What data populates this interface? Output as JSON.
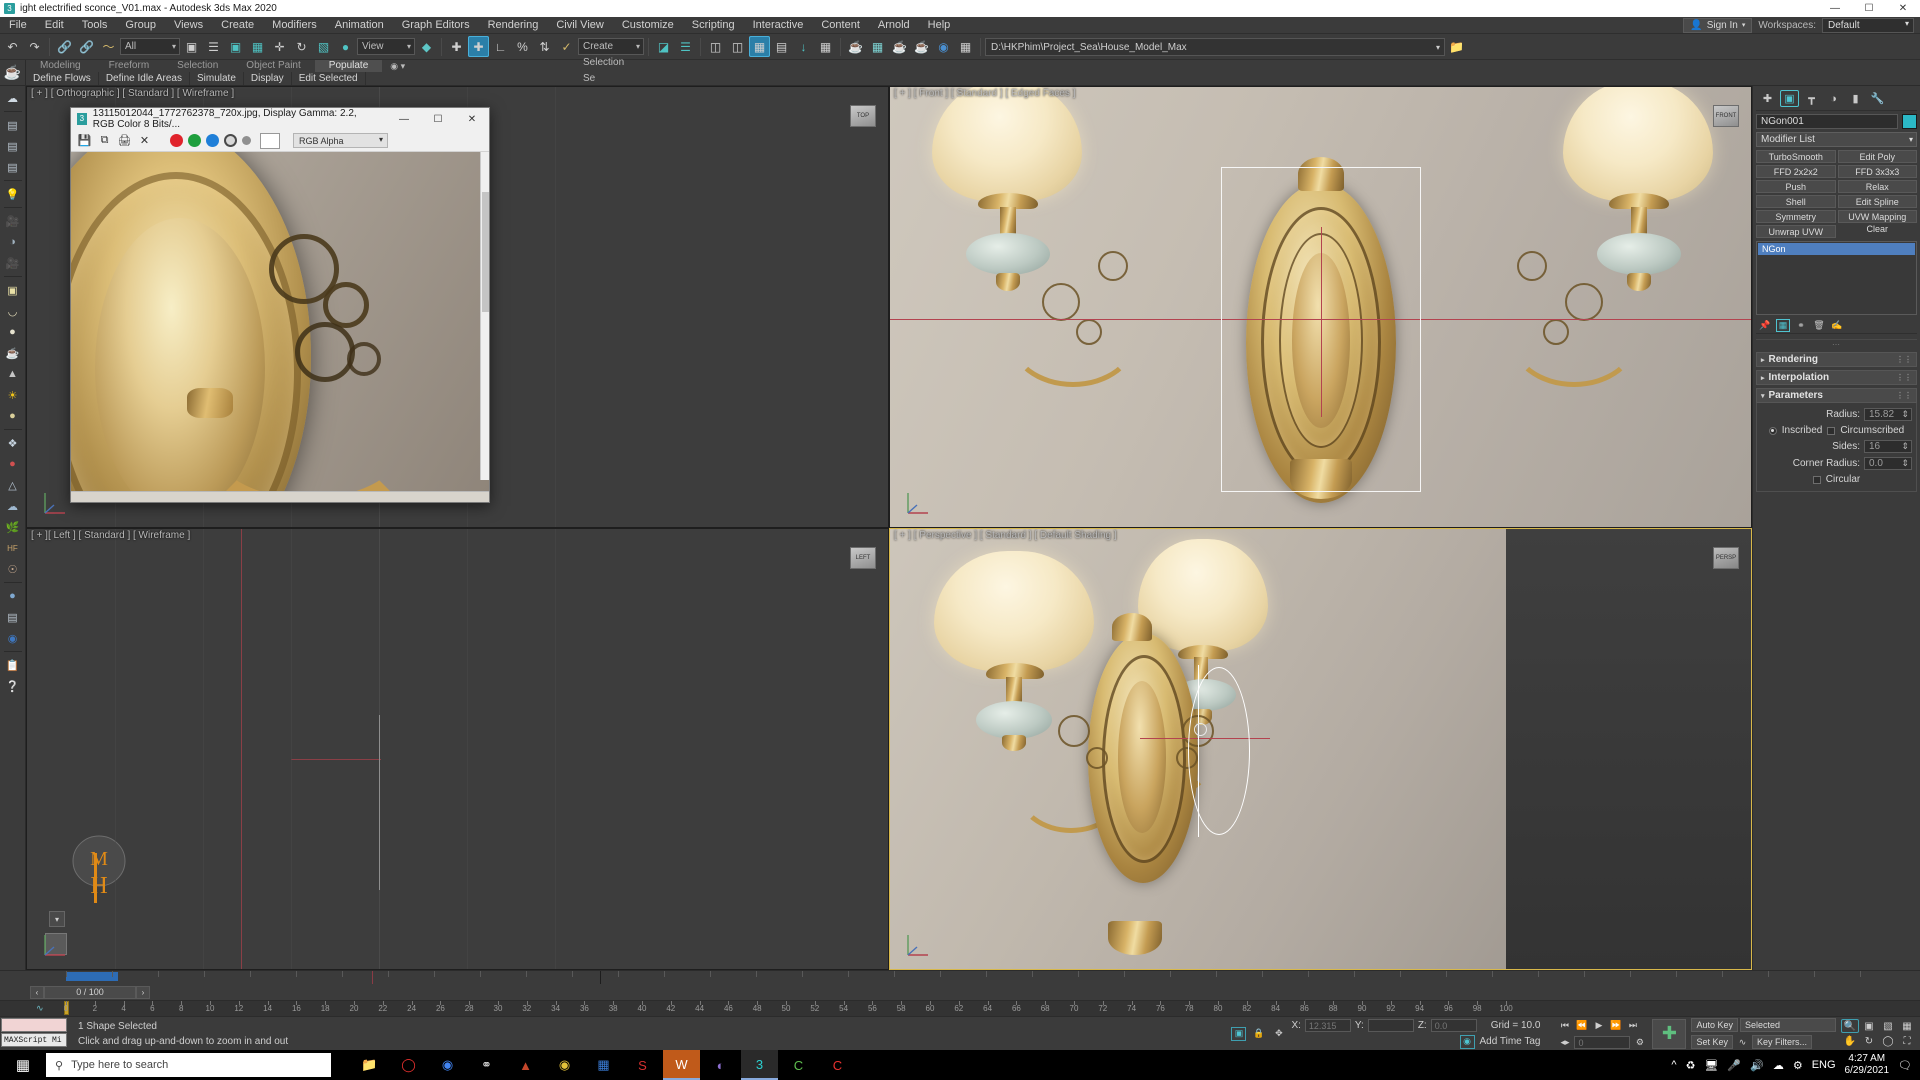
{
  "window": {
    "title": "ight electrified sconce_V01.max - Autodesk 3ds Max 2020",
    "app_icon": "3",
    "minimize": "—",
    "maximize": "☐",
    "close": "✕"
  },
  "menubar": {
    "items": [
      "File",
      "Edit",
      "Tools",
      "Group",
      "Views",
      "Create",
      "Modifiers",
      "Animation",
      "Graph Editors",
      "Rendering",
      "Civil View",
      "Customize",
      "Scripting",
      "Interactive",
      "Content",
      "Arnold",
      "Help"
    ],
    "sign_in": "Sign In",
    "workspaces_label": "Workspaces:",
    "workspace_value": "Default"
  },
  "toolbar": {
    "selection_filter": "All",
    "reference_coord": "View",
    "named_selection_set": "Create Selection Se",
    "project_path": "D:\\HKPhim\\Project_Sea\\House_Model_Max",
    "buttons": [
      "undo-icon",
      "redo-icon",
      "select-link-icon",
      "unlink-icon",
      "bind-spacewarp-icon",
      "select-object-icon",
      "select-by-name-icon",
      "rectangular-select-icon",
      "window-crossing-icon",
      "select-move-icon",
      "select-rotate-icon",
      "select-scale-icon",
      "placement-icon",
      "mirror-icon",
      "align-icon",
      "snap-toggle-icon",
      "angle-snap-icon",
      "percent-snap-icon",
      "spinner-snap-icon",
      "edit-named-selection-icon",
      "layer-manager-icon",
      "curve-editor-icon",
      "schematic-view-icon",
      "material-editor-icon",
      "render-setup-icon",
      "render-frame-icon",
      "render-production-icon",
      "render-iterative-icon",
      "activeshade-icon",
      "qr-icon",
      "grid-icon"
    ]
  },
  "ribbon": {
    "tabs": [
      "Modeling",
      "Freeform",
      "Selection",
      "Object Paint",
      "Populate"
    ],
    "active_tab": "Populate",
    "subtabs": [
      "Define Flows",
      "Define Idle Areas",
      "Simulate",
      "Display",
      "Edit Selected"
    ]
  },
  "left_toolbar": {
    "items": [
      "cloud-icon",
      "render-window-icon",
      "list-panel-icon",
      "list-panel-2-icon",
      "light-icon",
      "camera-icon",
      "helper-icon",
      "render-camera-icon",
      "box-material-icon",
      "dome-material-icon",
      "sphere-material-icon",
      "teapot-material-icon",
      "cone-material-icon",
      "sun-icon",
      "sphere-gold-icon",
      "particles-icon",
      "capsule-icon",
      "spacewarp-icon",
      "cloud-fx-icon",
      "grass-icon",
      "hair-fur-icon",
      "brain-icon",
      "glossy-sphere-icon",
      "render-to-texture-icon",
      "region-render-icon",
      "clipboard-icon",
      "help-icon"
    ]
  },
  "viewports": [
    {
      "name": "viewport-orthographic",
      "label": "[ + ] [ Orthographic ] [ Standard ] [ Wireframe ]",
      "cube": "TOP",
      "active": false
    },
    {
      "name": "viewport-front",
      "label": "[ + ] [ Front ] [ Standard ] [ Edged Faces ]",
      "cube": "FRONT",
      "active": false
    },
    {
      "name": "viewport-left",
      "label": "[ + ][ Left ] [ Standard ] [ Wireframe ]",
      "cube": "LEFT",
      "active": false
    },
    {
      "name": "viewport-perspective",
      "label": "[ + ] [ Perspective ] [ Standard ] [ Default Shading ]",
      "cube": "PERSP",
      "active": true
    }
  ],
  "image_viewer": {
    "title": "13115012044_1772762378_720x.jpg, Display Gamma: 2.2, RGB Color 8 Bits/...",
    "icon": "3",
    "minimize": "—",
    "maximize": "☐",
    "close": "✕",
    "tools": [
      "save-icon",
      "copy-icon",
      "print-icon",
      "clear-icon"
    ],
    "channels": [
      "red-channel-dot",
      "green-channel-dot",
      "blue-channel-dot",
      "alpha-channel-dot",
      "mono-channel-dot"
    ],
    "channel_colors": {
      "red": "#e0232b",
      "green": "#1f9f3d",
      "blue": "#1f7fd8",
      "alpha": "#2f2f2f",
      "mono": "#808080"
    },
    "mode": "RGB Alpha"
  },
  "command_panel": {
    "tabs": [
      "create-tab-icon",
      "modify-tab-icon",
      "hierarchy-tab-icon",
      "motion-tab-icon",
      "display-tab-icon",
      "utilities-tab-icon"
    ],
    "active_tab_index": 1,
    "object_name": "NGon001",
    "object_color": "#2bb8c6",
    "modifier_list_label": "Modifier List",
    "modifier_buttons": [
      "TurboSmooth",
      "Edit Poly",
      "FFD 2x2x2",
      "FFD 3x3x3",
      "Push",
      "Relax",
      "Shell",
      "Edit Spline",
      "Symmetry",
      "UVW Mapping Clear",
      "Unwrap UVW"
    ],
    "stack_items": [
      "NGon"
    ],
    "stack_selected": "NGon",
    "stack_tools": [
      "pin-stack-icon",
      "show-end-result-icon",
      "make-unique-icon",
      "remove-modifier-icon",
      "configure-sets-icon"
    ],
    "rollouts": [
      {
        "name": "Rendering",
        "expanded": false
      },
      {
        "name": "Interpolation",
        "expanded": false
      },
      {
        "name": "Parameters",
        "expanded": true
      }
    ],
    "parameters": {
      "radius_label": "Radius:",
      "radius_value": "15.82",
      "inscribed_label": "Inscribed",
      "inscribed_selected": true,
      "circumscribed_label": "Circumscribed",
      "circumscribed_selected": false,
      "sides_label": "Sides:",
      "sides_value": "16",
      "corner_radius_label": "Corner Radius:",
      "corner_radius_value": "0.0",
      "circular_label": "Circular",
      "circular_checked": false
    }
  },
  "timeline": {
    "frame_display": "0 / 100",
    "prev_arrow": "‹",
    "next_arrow": "›",
    "ticks": [
      "0",
      "2",
      "4",
      "6",
      "8",
      "10",
      "12",
      "14",
      "16",
      "18",
      "20",
      "22",
      "24",
      "26",
      "28",
      "30",
      "32",
      "34",
      "36",
      "38",
      "40",
      "42",
      "44",
      "46",
      "48",
      "50",
      "52",
      "54",
      "56",
      "58",
      "60",
      "62",
      "64",
      "66",
      "68",
      "70",
      "72",
      "74",
      "76",
      "78",
      "80",
      "82",
      "84",
      "86",
      "88",
      "90",
      "92",
      "94",
      "96",
      "98",
      "100"
    ]
  },
  "statusbar": {
    "mini_listener": "MAXScript Mi",
    "selection_status": "1 Shape Selected",
    "prompt": "Click and drag up-and-down to zoom in and out",
    "x_label": "X:",
    "x_value": "12.315",
    "y_label": "Y:",
    "y_value": "",
    "z_label": "Z:",
    "z_value": "0.0",
    "grid_label": "Grid = 10.0",
    "add_time_tag": "Add Time Tag",
    "auto_key": "Auto Key",
    "set_key": "Set Key",
    "key_mode": "Selected",
    "key_filters": "Key Filters...",
    "key_frame_value": "0",
    "transport": [
      "go-to-start-icon",
      "previous-frame-icon",
      "play-animation-icon",
      "next-frame-icon",
      "go-to-end-icon"
    ],
    "nav_buttons": [
      "zoom-icon",
      "zoom-all-icon",
      "zoom-extents-icon",
      "zoom-region-icon",
      "pan-icon",
      "orbit-icon",
      "maximize-viewport-icon",
      "field-of-view-icon"
    ]
  },
  "taskbar": {
    "search_placeholder": "Type here to search",
    "search_icon": "search-icon",
    "start_icon": "windows-start-icon",
    "apps": [
      {
        "name": "file-explorer",
        "glyph": "🗂",
        "color": "#f2b33d",
        "active": false
      },
      {
        "name": "opera-browser",
        "glyph": "O",
        "color": "#e8312f",
        "active": false
      },
      {
        "name": "chrome-browser",
        "glyph": "◉",
        "color": "#4285f4",
        "active": false
      },
      {
        "name": "photoshop-app",
        "glyph": "@",
        "color": "#d8d8d8",
        "active": false
      },
      {
        "name": "media-app",
        "glyph": "▲",
        "color": "#c4462a",
        "active": false
      },
      {
        "name": "film-app",
        "glyph": "◎",
        "color": "#e3c23a",
        "active": false
      },
      {
        "name": "photos-app",
        "glyph": "▣",
        "color": "#3a7bd5",
        "active": false
      },
      {
        "name": "skype-app",
        "glyph": "S",
        "color": "#d32f2f",
        "active": false
      },
      {
        "name": "word-app",
        "glyph": "W",
        "color": "#ffffff",
        "active": true
      },
      {
        "name": "utorrent-app",
        "glyph": "◐",
        "color": "#8d6fd1",
        "active": false
      },
      {
        "name": "3dsmax-app",
        "glyph": "3",
        "color": "#2b9e9e",
        "active": true
      },
      {
        "name": "coreldraw-app",
        "glyph": "C",
        "color": "#5fbf4f",
        "active": false
      },
      {
        "name": "corelphoto-app",
        "glyph": "C",
        "color": "#e8312f",
        "active": false
      }
    ],
    "tray": [
      "show-hidden-icon",
      "onedrive-sync-icon",
      "network-icon",
      "microphone-icon",
      "volume-icon",
      "cloud-icon",
      "bluetooth-icon"
    ],
    "language": "ENG",
    "time": "4:27 AM",
    "date": "6/29/2021",
    "notification_icon": "notification-icon"
  },
  "colors": {
    "ui_bg": "#3b3b3b",
    "panel_bg": "#4a4a4a",
    "accent": "#2bb8c6",
    "selected_row": "#4f7fbf",
    "active_viewport_border": "#d8b84a"
  }
}
